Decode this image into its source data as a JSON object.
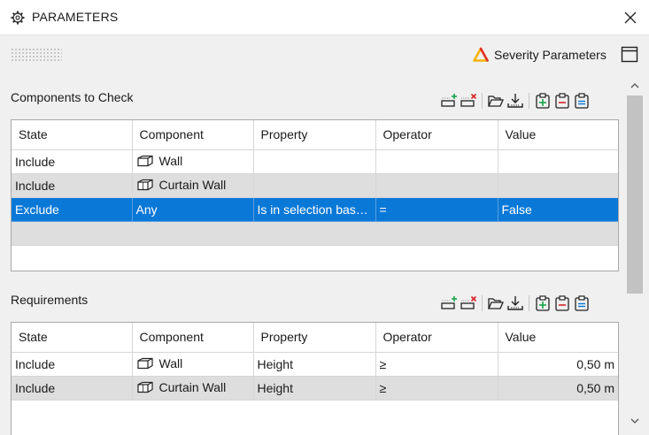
{
  "window": {
    "title": "PARAMETERS",
    "icon": "gear-icon",
    "close_icon": "close-icon"
  },
  "header": {
    "severity_label": "Severity Parameters",
    "severity_icon": "warning-triangle-icon",
    "maximize_icon": "window-restore-icon"
  },
  "colors": {
    "selection": "#0a78d7",
    "alt_row": "#dedede",
    "add_accent": "#1aa64a",
    "remove_accent": "#d8232a"
  },
  "components_to_check": {
    "label": "Components to Check",
    "columns": [
      "State",
      "Component",
      "Property",
      "Operator",
      "Value"
    ],
    "rows": [
      {
        "state": "Include",
        "component": "Wall",
        "property": "",
        "operator": "",
        "value": ""
      },
      {
        "state": "Include",
        "component": "Curtain Wall",
        "property": "",
        "operator": "",
        "value": ""
      },
      {
        "state": "Exclude",
        "component": "Any",
        "property": "Is in selection bask...",
        "operator": "=",
        "value": "False"
      }
    ]
  },
  "requirements": {
    "label": "Requirements",
    "columns": [
      "State",
      "Component",
      "Property",
      "Operator",
      "Value"
    ],
    "rows": [
      {
        "state": "Include",
        "component": "Wall",
        "property": "Height",
        "operator": "≥",
        "value": "0,50 m"
      },
      {
        "state": "Include",
        "component": "Curtain Wall",
        "property": "Height",
        "operator": "≥",
        "value": "0,50 m"
      }
    ]
  },
  "toolbar_icons": [
    "add-row-icon",
    "remove-row-icon",
    "open-folder-icon",
    "import-icon",
    "clipboard-add-icon",
    "clipboard-remove-icon",
    "clipboard-list-icon"
  ]
}
